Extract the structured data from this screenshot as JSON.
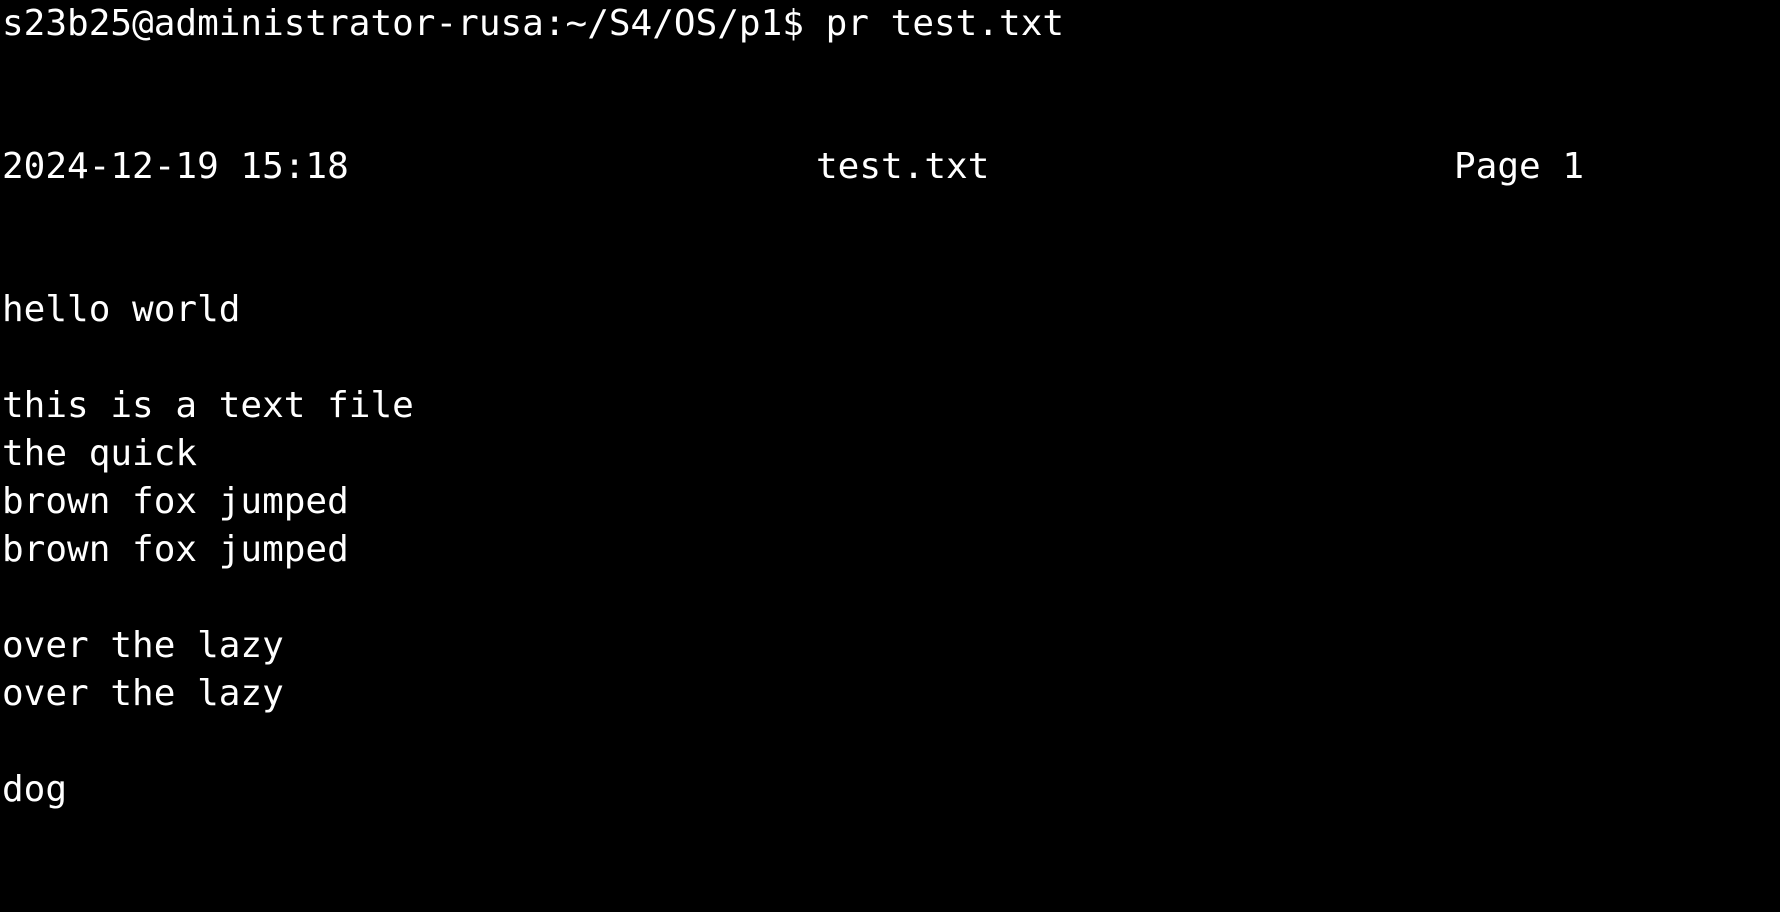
{
  "terminal": {
    "prompt": "s23b25@administrator-rusa:~/S4/OS/p1$",
    "command": "pr test.txt",
    "header": {
      "datetime": "2024-12-19 15:18",
      "filename": "test.txt",
      "page": "Page 1"
    },
    "lines": [
      "hello world",
      "",
      "this is a text file",
      "the quick",
      "brown fox jumped",
      "brown fox jumped",
      "",
      "over the lazy",
      "over the lazy",
      "",
      "dog"
    ],
    "colors": {
      "background": "#000000",
      "foreground": "#ffffff"
    }
  }
}
